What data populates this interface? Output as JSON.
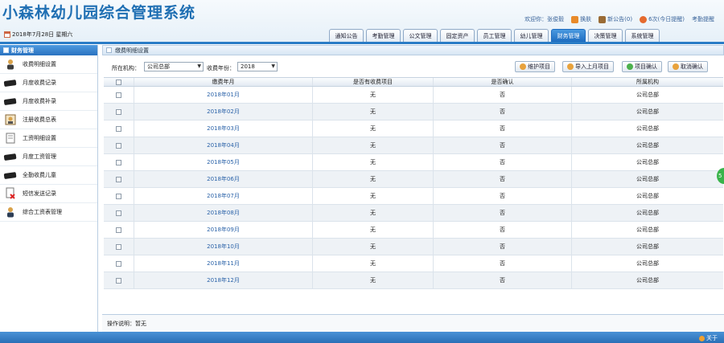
{
  "app": {
    "title": "小森林幼儿园综合管理系统",
    "date": "2018年7月28日 星期六"
  },
  "user_bar": {
    "welcome": "欢迎你：张俊毅",
    "switch": "换肤",
    "notice": "新公告(0)",
    "unread": "6次(今日提醒)",
    "logout": "考勤提醒"
  },
  "nav_tabs": [
    "通知公告",
    "考勤管理",
    "公文管理",
    "固定资产",
    "员工管理",
    "幼儿管理",
    "财务管理",
    "决策管理",
    "系统管理"
  ],
  "sidebar": {
    "title": "财务管理",
    "items": [
      {
        "label": "收费明细设置",
        "icon": "person-icon"
      },
      {
        "label": "月度收费记录",
        "icon": "card-icon"
      },
      {
        "label": "月度收费补录",
        "icon": "card-icon"
      },
      {
        "label": "注册收费总表",
        "icon": "register-icon"
      },
      {
        "label": "工资明细设置",
        "icon": "slip-icon"
      },
      {
        "label": "月度工资管理",
        "icon": "card-icon"
      },
      {
        "label": "全勤收费儿童",
        "icon": "card-icon"
      },
      {
        "label": "短信发送记录",
        "icon": "document-delete-icon"
      },
      {
        "label": "综合工资表管理",
        "icon": "manager-icon"
      }
    ]
  },
  "panel": {
    "title": "缴费明细设置"
  },
  "filters": {
    "org_label": "所在机构：",
    "org_value": "公司总部",
    "year_label": "收费年份：",
    "year_value": "2018"
  },
  "buttons": {
    "maintain": "维护项目",
    "import_last": "导入上月项目",
    "confirm": "项目确认",
    "unconfirm": "取消确认"
  },
  "table": {
    "headers": [
      "",
      "缴费年月",
      "是否有收费项目",
      "是否确认",
      "所属机构"
    ],
    "rows": [
      [
        "2018年01月",
        "无",
        "否",
        "公司总部"
      ],
      [
        "2018年02月",
        "无",
        "否",
        "公司总部"
      ],
      [
        "2018年03月",
        "无",
        "否",
        "公司总部"
      ],
      [
        "2018年04月",
        "无",
        "否",
        "公司总部"
      ],
      [
        "2018年05月",
        "无",
        "否",
        "公司总部"
      ],
      [
        "2018年06月",
        "无",
        "否",
        "公司总部"
      ],
      [
        "2018年07月",
        "无",
        "否",
        "公司总部"
      ],
      [
        "2018年08月",
        "无",
        "否",
        "公司总部"
      ],
      [
        "2018年09月",
        "无",
        "否",
        "公司总部"
      ],
      [
        "2018年10月",
        "无",
        "否",
        "公司总部"
      ],
      [
        "2018年11月",
        "无",
        "否",
        "公司总部"
      ],
      [
        "2018年12月",
        "无",
        "否",
        "公司总部"
      ]
    ]
  },
  "help": "操作说明：暂无",
  "footer": {
    "about": "关于"
  },
  "colors": {
    "accent": "#2a7cc6",
    "active_tab": "#1d6cc0",
    "link": "#2a62a8"
  }
}
